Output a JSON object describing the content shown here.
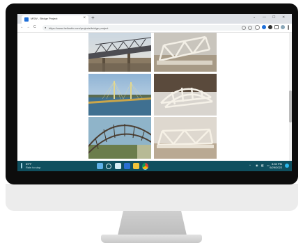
{
  "browser": {
    "tab_title": "MSW - Bridge Project",
    "tab_close": "×",
    "new_tab": "+",
    "url": "https://www.hellostix.com/projects/bridge-project",
    "nav": {
      "back": "←",
      "forward": "→",
      "reload": "C"
    },
    "window_controls": {
      "minimize": "—",
      "maximize": "☐",
      "close": "✕",
      "tabs_menu": "⌄"
    }
  },
  "gallery": {
    "images": [
      {
        "icon": "steel-truss-bridge-photo",
        "alt": "Steel truss bridge"
      },
      {
        "icon": "stick-truss-model-photo",
        "alt": "Stick truss bridge model"
      },
      {
        "icon": "cable-stayed-bridge-photo",
        "alt": "Cable-stayed bridge"
      },
      {
        "icon": "arch-stick-model-photo",
        "alt": "Arched stick bridge model"
      },
      {
        "icon": "steel-arch-underside-photo",
        "alt": "Steel arch underside"
      },
      {
        "icon": "truss-model-table-photo",
        "alt": "Truss bridge model on table"
      }
    ]
  },
  "taskbar": {
    "weather": {
      "temp": "69°F",
      "condition": "Rain to stop"
    },
    "time": "8:30 PM",
    "date": "6/29/2022"
  },
  "colors": {
    "taskbar": "#0f4f5f",
    "accent": "#1e6fd9"
  }
}
